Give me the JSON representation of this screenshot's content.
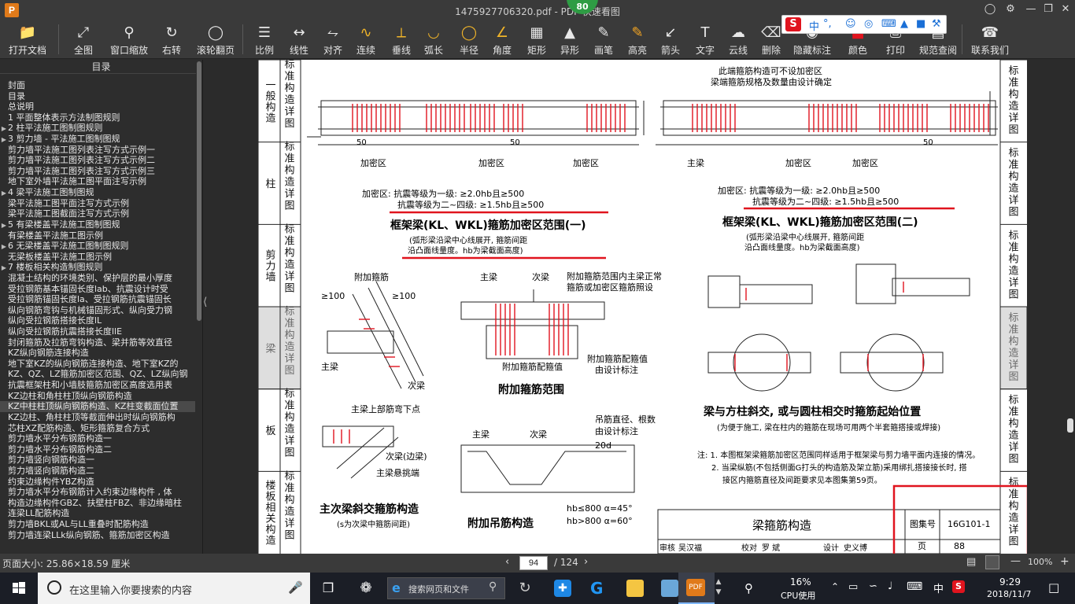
{
  "window": {
    "title": "1475927706320.pdf - PDF 快速看图",
    "badge": "80"
  },
  "toolbar": [
    {
      "label": "打开文档",
      "icon": "folder-icon"
    },
    {
      "label": "全图",
      "icon": "fit-page-icon"
    },
    {
      "label": "窗口缩放",
      "icon": "zoom-icon"
    },
    {
      "label": "右转",
      "icon": "rotate-right-icon"
    },
    {
      "label": "滚轮翻页",
      "icon": "mouse-wheel-icon"
    },
    {
      "label": "比例",
      "icon": "ruler-icon"
    },
    {
      "label": "线性",
      "icon": "linear-measure-icon"
    },
    {
      "label": "对齐",
      "icon": "align-measure-icon"
    },
    {
      "label": "连续",
      "icon": "continuous-measure-icon"
    },
    {
      "label": "垂线",
      "icon": "perpendicular-icon"
    },
    {
      "label": "弧长",
      "icon": "arc-length-icon"
    },
    {
      "label": "半径",
      "icon": "radius-icon"
    },
    {
      "label": "角度",
      "icon": "angle-icon"
    },
    {
      "label": "矩形",
      "icon": "rectangle-area-icon"
    },
    {
      "label": "异形",
      "icon": "polygon-area-icon"
    },
    {
      "label": "画笔",
      "icon": "pen-icon"
    },
    {
      "label": "高亮",
      "icon": "highlight-icon"
    },
    {
      "label": "箭头",
      "icon": "arrow-icon"
    },
    {
      "label": "文字",
      "icon": "text-icon"
    },
    {
      "label": "云线",
      "icon": "cloud-line-icon"
    },
    {
      "label": "删除",
      "icon": "eraser-icon"
    },
    {
      "label": "隐藏标注",
      "icon": "hide-markup-icon"
    },
    {
      "label": "颜色",
      "icon": "color-icon"
    },
    {
      "label": "打印",
      "icon": "print-icon"
    },
    {
      "label": "规范查阅",
      "icon": "spec-lookup-icon"
    },
    {
      "label": "联系我们",
      "icon": "contact-icon"
    }
  ],
  "ime": {
    "lang": "中",
    "punct": "°,"
  },
  "sidebar": {
    "title": "目录",
    "items": [
      {
        "label": "封面",
        "arrow": ""
      },
      {
        "label": "目录",
        "arrow": ""
      },
      {
        "label": "总说明",
        "arrow": ""
      },
      {
        "label": "1 平面整体表示方法制图规则",
        "arrow": ""
      },
      {
        "label": "2 柱平法施工图制图规则",
        "arrow": "▶"
      },
      {
        "label": "3 剪力墙 - 平法施工图制图规",
        "arrow": "▶"
      },
      {
        "label": "剪力墙平法施工图列表注写方式示例一",
        "arrow": ""
      },
      {
        "label": "剪力墙平法施工图列表注写方式示例二",
        "arrow": ""
      },
      {
        "label": "剪力墙平法施工图列表注写方式示例三",
        "arrow": ""
      },
      {
        "label": "地下室外墙平法施工图平面注写示例",
        "arrow": ""
      },
      {
        "label": "4 梁平法施工图制图规",
        "arrow": "▶"
      },
      {
        "label": "梁平法施工图平面注写方式示例",
        "arrow": ""
      },
      {
        "label": "梁平法施工图截面注写方式示例",
        "arrow": ""
      },
      {
        "label": "5 有梁楼盖平法施工图制图规",
        "arrow": "▶"
      },
      {
        "label": "有梁楼盖平法施工图示例",
        "arrow": ""
      },
      {
        "label": "6 无梁楼盖平法施工图制图规则",
        "arrow": "▶"
      },
      {
        "label": "无梁板楼盖平法施工图示例",
        "arrow": ""
      },
      {
        "label": "7 楼板相关构造制图规则",
        "arrow": "▶"
      },
      {
        "label": "混凝土结构的环境类别、保护层的最小厚度",
        "arrow": ""
      },
      {
        "label": "受拉钢筋基本锚固长度lab、抗震设计时受",
        "arrow": ""
      },
      {
        "label": "受拉钢筋锚固长度la、受拉钢筋抗震锚固长",
        "arrow": ""
      },
      {
        "label": "纵向钢筋弯钩与机械锚固形式、纵向受力钢",
        "arrow": ""
      },
      {
        "label": "纵向受拉钢筋搭接长度lL",
        "arrow": ""
      },
      {
        "label": "纵向受拉钢筋抗震搭接长度llE",
        "arrow": ""
      },
      {
        "label": "封闭箍筋及拉筋弯钩构造、梁并筋等效直径",
        "arrow": ""
      },
      {
        "label": "KZ纵向钢筋连接构造",
        "arrow": ""
      },
      {
        "label": "地下室KZ的纵向钢筋连接构造、地下室KZ的",
        "arrow": ""
      },
      {
        "label": "KZ、QZ、LZ箍筋加密区范围、QZ、LZ纵向钢",
        "arrow": ""
      },
      {
        "label": "抗震框架柱和小墙肢箍筋加密区高度选用表",
        "arrow": ""
      },
      {
        "label": "KZ边柱和角柱柱顶纵向钢筋构造",
        "arrow": ""
      },
      {
        "label": "KZ中柱柱顶纵向钢筋构造、KZ柱变截面位置",
        "arrow": ""
      },
      {
        "label": "KZ边柱、角柱柱顶等截面伸出时纵向钢筋构",
        "arrow": ""
      },
      {
        "label": "芯柱XZ配筋构造、矩形箍筋复合方式",
        "arrow": ""
      },
      {
        "label": "剪力墙水平分布钢筋构造一",
        "arrow": ""
      },
      {
        "label": "剪力墙水平分布钢筋构造二",
        "arrow": ""
      },
      {
        "label": "剪力墙竖向钢筋构造一",
        "arrow": ""
      },
      {
        "label": "剪力墙竖向钢筋构造二",
        "arrow": ""
      },
      {
        "label": "约束边缘构件YBZ构造",
        "arrow": ""
      },
      {
        "label": "剪力墙水平分布钢筋计入约束边缘构件 , 体",
        "arrow": ""
      },
      {
        "label": "构造边缘构件GBZ、扶壁柱FBZ、非边缘暗柱",
        "arrow": ""
      },
      {
        "label": "连梁LL配筋构造",
        "arrow": ""
      },
      {
        "label": "剪力墙BKL或AL与LL重叠时配筋构造",
        "arrow": ""
      },
      {
        "label": "剪力墙连梁LLk纵向钢筋、箍筋加密区构造",
        "arrow": ""
      }
    ]
  },
  "drawing": {
    "left_tabs": [
      {
        "a": "一般构造",
        "b": "标准构造详图"
      },
      {
        "a": "柱",
        "b": "标准构造详图"
      },
      {
        "a": "剪力墙",
        "b": "标准构造详图"
      },
      {
        "a": "梁",
        "b": "标准构造详图"
      },
      {
        "a": "板",
        "b": "标准构造详图"
      },
      {
        "a": "楼板相关构造",
        "b": "标准构造详图"
      }
    ],
    "right_tabs": [
      "标准构造详图",
      "标准构造详图",
      "标准构造详图",
      "标准构造详图",
      "标准构造详图",
      "标准构造详图"
    ],
    "note_top": "此端箍筋构造可不设加密区",
    "note_top2": "梁端箍筋规格及数量由设计确定",
    "dense": "加密区",
    "dim50": "50",
    "main_rebar": "主梁",
    "dense_req1": "加密区: 抗震等级为一级: ≥2.0hb且≥500",
    "dense_req2": "抗震等级为二~四级: ≥1.5hb且≥500",
    "title1": "框架梁(KL、WKL)箍筋加密区范围(一)",
    "title2": "框架梁(KL、WKL)箍筋加密区范围(二)",
    "sub1a": "(弧形梁沿梁中心线展开, 箍筋间距",
    "sub1b": "沿凸面线量度。hb为梁截面高度)",
    "extra_stirrup": "附加箍筋",
    "gt100": "≥100",
    "main_beam": "主梁",
    "secondary_beam": "次梁",
    "extra_note1": "附加箍筋范围内主梁正常",
    "extra_note2": "箍筋或加密区箍筋照设",
    "extra_config": "附加箍筋配箍值",
    "by_design": "由设计标注",
    "title_extra": "附加箍筋范围",
    "title_col": "梁与方柱斜交, 或与圆柱相交时箍筋起始位置",
    "sub_col": "(为便于施工, 梁在柱内的箍筋在现场可用两个半套箍搭接或焊接)",
    "main_top": "主梁上部筋弯下点",
    "secondary_edge": "次梁(边梁)",
    "main_cantilever": "主梁悬挑端",
    "title_skew": "主次梁斜交箍筋构造",
    "sub_skew": "(s为次梁中箍筋间距)",
    "hanger_note1": "吊筋直径、根数",
    "hanger_note2": "由设计标注",
    "d20": "20d",
    "hb800a": "hb≤800  α=45°",
    "hb800b": "hb>800  α=60°",
    "title_hanger": "附加吊筋构造",
    "note1": "注: 1. 本图框架梁箍筋加密区范围同样适用于框架梁与剪力墙平面内连接的情况。",
    "note2": "2. 当梁纵筋(不包括侧面G打头的构造筋及架立筋)采用绑扎搭接接长时, 搭",
    "note3": "接区内箍筋直径及间距要求见本图集第59页。",
    "tb_title": "梁箍筋构造",
    "tb_atlas_label": "图集号",
    "tb_atlas": "16G101-1",
    "tb_page_label": "页",
    "tb_page": "88",
    "tb_review": "审核",
    "tb_review_name": "吴汉福",
    "tb_check": "校对",
    "tb_check_name": "罗 斌",
    "tb_design": "设计",
    "tb_design_name": "史义博"
  },
  "status": {
    "page_size": "页面大小: 25.86×18.59 厘米",
    "page_current": "94",
    "page_total": "/ 124",
    "zoom": "100%"
  },
  "taskbar": {
    "search_placeholder": "在这里输入你要搜索的内容",
    "browser_search": "搜索网页和文件",
    "cpu": "16%",
    "cpu_label": "CPU使用",
    "ime": "中",
    "time": "9:29",
    "date": "2018/11/7"
  },
  "colors": {
    "accent_red": "#e0141e",
    "highlight_box": "#e0141e",
    "toolbar_bg": "#3a3a3a"
  }
}
